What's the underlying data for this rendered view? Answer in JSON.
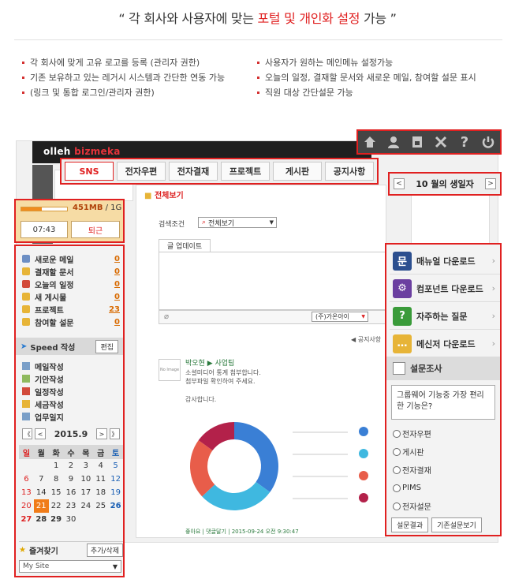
{
  "headline": {
    "prefix": "“ 각 회사와 사용자에 맞는 ",
    "highlight": "포털 및 개인화 설정",
    "suffix": " 가능 ”"
  },
  "features_left": [
    "각 회사에 맞게 고유 로고를 등록 (관리자 권한)",
    "기존 보유하고 있는 레거시 시스템과 간단한 연동 가능",
    "(링크 및 통합 로그인/관리자 권한)"
  ],
  "features_right": [
    "사용자가 원하는 메인메뉴 설정가능",
    "오늘의 일정, 결재할 문서와 새로운 메일, 참여할 설문 표시",
    "직원 대상 간단설문 가능"
  ],
  "app": {
    "logo_prefix": "olleh ",
    "logo_brand": "bizmeka"
  },
  "tabs": [
    {
      "label": "SNS",
      "active": true
    },
    {
      "label": "전자우편"
    },
    {
      "label": "전자결재"
    },
    {
      "label": "프로젝트"
    },
    {
      "label": "게시판"
    },
    {
      "label": "공지사항"
    }
  ],
  "birthday": {
    "title": "10 월의 생일자",
    "prev": "<",
    "next": ">"
  },
  "storage": {
    "used": "451MB",
    "total": " / 1G",
    "fill": 0.45,
    "time": "07:43",
    "leave": "퇴근"
  },
  "menu": [
    {
      "label": "새로운 메일",
      "count": "0",
      "color": "#6d8fc4"
    },
    {
      "label": "결재할 문서",
      "count": "0",
      "color": "#e7b437"
    },
    {
      "label": "오늘의 일정",
      "count": "0",
      "color": "#d24a3a"
    },
    {
      "label": "새 게시물",
      "count": "0",
      "color": "#e7b437"
    },
    {
      "label": "프로젝트",
      "count": "23",
      "color": "#e7b437"
    },
    {
      "label": "참여할 설문",
      "count": "0",
      "color": "#e7b437"
    }
  ],
  "speed": {
    "title": "Speed 작성",
    "edit": "편집",
    "items": [
      {
        "label": "메일작성",
        "color": "#7a9fc8"
      },
      {
        "label": "기안작성",
        "color": "#8fba5e"
      },
      {
        "label": "일정작성",
        "color": "#d24a3a"
      },
      {
        "label": "세금작성",
        "color": "#e7b437"
      },
      {
        "label": "업무일지",
        "color": "#7a9fc8"
      }
    ]
  },
  "calendar": {
    "title": "2015.9",
    "first_prev": "《",
    "prev": "<",
    "next": ">",
    "last_next": "》",
    "weekdays": [
      "일",
      "월",
      "화",
      "수",
      "목",
      "금",
      "토"
    ],
    "days": [
      "",
      "",
      "1",
      "2",
      "3",
      "4",
      "5",
      "6",
      "7",
      "8",
      "9",
      "10",
      "11",
      "12",
      "13",
      "14",
      "15",
      "16",
      "17",
      "18",
      "19",
      "20",
      "21",
      "22",
      "23",
      "24",
      "25",
      "26",
      "27",
      "28",
      "29",
      "30",
      "",
      "",
      ""
    ],
    "today": "21"
  },
  "favorites": {
    "title": "즐겨찾기",
    "add": "추가/삭제",
    "select": "My Site"
  },
  "center": {
    "page_title": "전체보기",
    "filter_label": "검색조건",
    "filter_value": "전체보기",
    "write_tab": "글 업데이트",
    "company": "(주)가온아이",
    "notice": "공지사항",
    "no_image": "No Image",
    "post_author": "박오현 ▶ 사업팀",
    "post_line1": "소셜미디어 통계 첨부합니다.",
    "post_line2": "첨부파일 확인하여 주세요.",
    "post_thanks": "감사합니다.",
    "post_foot": "좋아요 | 댓글달기 | 2015-09-24 오전 9:30:47"
  },
  "right_menu": [
    {
      "label": "매뉴얼 다운로드",
      "icon": "문",
      "color": "#2c4f8f"
    },
    {
      "label": "컴포넌트 다운로드",
      "icon": "⚙",
      "color": "#6b3fa0"
    },
    {
      "label": "자주하는 질문",
      "icon": "?",
      "color": "#3a9b3a"
    },
    {
      "label": "메신저 다운로드",
      "icon": "…",
      "color": "#e7b437"
    }
  ],
  "survey": {
    "title": "설문조사",
    "question": "그룹웨어 기능중 가장 편리한 기능은?",
    "options": [
      "전자우편",
      "게시판",
      "전자결재",
      "PIMS",
      "전자설문"
    ],
    "result_btn": "설문결과",
    "prev_btn": "기존설문보기"
  },
  "donut": {
    "values": [
      35,
      28,
      22,
      15
    ],
    "colors": [
      "#3a7fd5",
      "#3fb8e0",
      "#e85d4a",
      "#b3214a"
    ]
  }
}
